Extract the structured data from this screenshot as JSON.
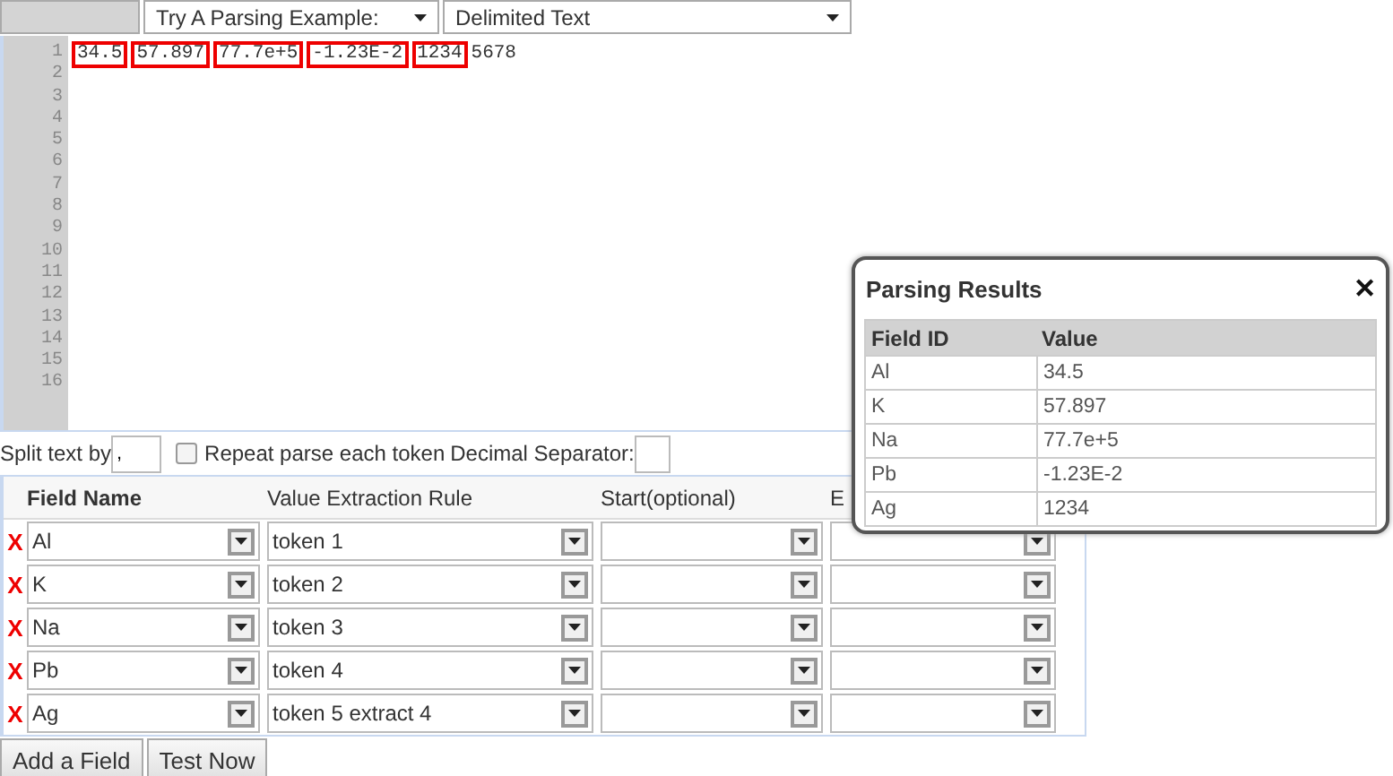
{
  "toolbar": {
    "example_select": "Try A Parsing Example:",
    "format_select": "Delimited Text"
  },
  "editor": {
    "line_numbers": [
      "1",
      "2",
      "3",
      "4",
      "5",
      "6",
      "7",
      "8",
      "9",
      "10",
      "11",
      "12",
      "13",
      "14",
      "15",
      "16"
    ],
    "tokens": [
      "34.5",
      "57.897",
      "77.7e+5",
      "-1.23E-2",
      "1234"
    ],
    "rest": "5678"
  },
  "options": {
    "split_label": "Split text by",
    "split_value": ",",
    "repeat_label": "Repeat parse each token",
    "repeat_checked": false,
    "decimal_label": "Decimal Separator:"
  },
  "fields_table": {
    "columns": [
      "Field Name",
      "Value Extraction Rule",
      "Start(optional)",
      "E"
    ],
    "rows": [
      {
        "remove": "X",
        "name": "Al",
        "rule": "token 1"
      },
      {
        "remove": "X",
        "name": "K",
        "rule": "token 2"
      },
      {
        "remove": "X",
        "name": "Na",
        "rule": "token 3"
      },
      {
        "remove": "X",
        "name": "Pb",
        "rule": "token 4"
      },
      {
        "remove": "X",
        "name": "Ag",
        "rule": "token 5 extract 4"
      }
    ]
  },
  "buttons": [
    "Add a Field",
    "Test Now"
  ],
  "results_dialog": {
    "title": "Parsing Results",
    "close": "✕",
    "columns": [
      "Field ID",
      "Value"
    ],
    "rows": [
      [
        "Al",
        "34.5"
      ],
      [
        "K",
        "57.897"
      ],
      [
        "Na",
        "77.7e+5"
      ],
      [
        "Pb",
        "-1.23E-2"
      ],
      [
        "Ag",
        "1234"
      ]
    ]
  }
}
